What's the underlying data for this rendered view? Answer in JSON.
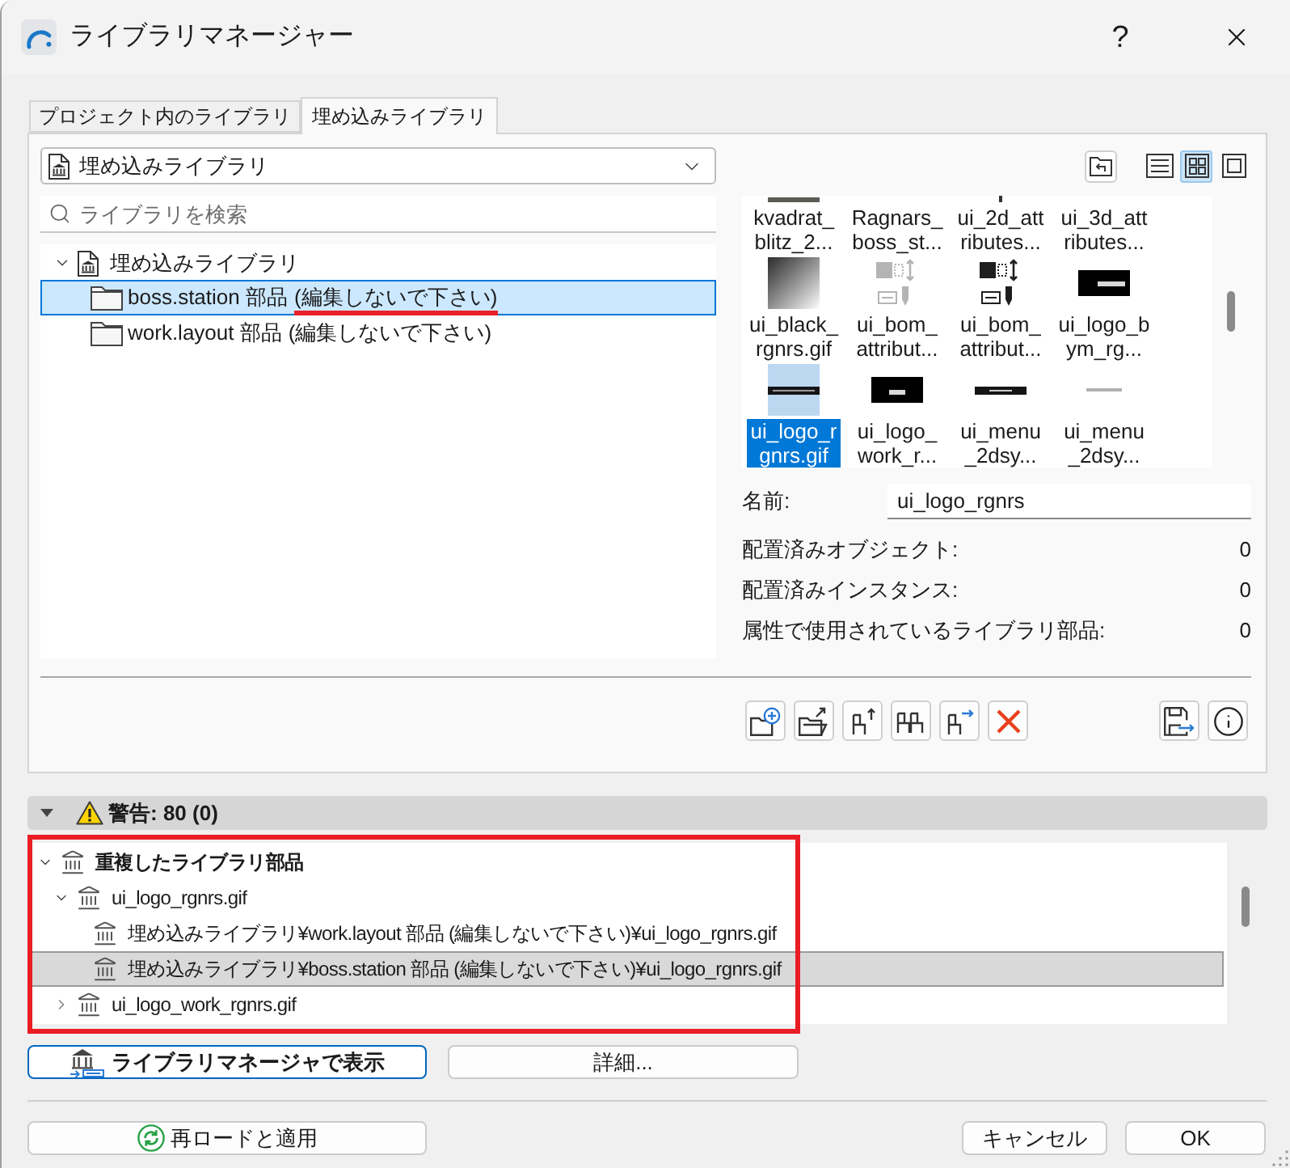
{
  "window": {
    "title": "ライブラリマネージャー",
    "help": "?"
  },
  "tabs": [
    {
      "label": "プロジェクト内のライブラリ",
      "selected": false
    },
    {
      "label": "埋め込みライブラリ",
      "selected": true
    }
  ],
  "library_select": {
    "value": "埋め込みライブラリ"
  },
  "search": {
    "placeholder": "ライブラリを検索"
  },
  "library_tree": [
    {
      "label": "埋め込みライブラリ",
      "expanded": true,
      "selected": false,
      "children": [
        {
          "name": "boss.station 部品",
          "note": "(編集しないで下さい)",
          "selected": true,
          "underlined": true
        },
        {
          "name": "work.layout 部品",
          "note": "(編集しないで下さい)",
          "selected": false,
          "underlined": false
        }
      ]
    }
  ],
  "view_modes": [
    {
      "kind": "list",
      "selected": false
    },
    {
      "kind": "grid",
      "selected": true
    },
    {
      "kind": "preview",
      "selected": false
    }
  ],
  "thumbnails": [
    {
      "lines": [
        "kvadrat_",
        "blitz_2..."
      ],
      "kind": "cut-bar",
      "selected": false
    },
    {
      "lines": [
        "Ragnars_",
        "boss_st..."
      ],
      "kind": "blank",
      "selected": false
    },
    {
      "lines": [
        "ui_2d_att",
        "ributes..."
      ],
      "kind": "cut-mark",
      "selected": false
    },
    {
      "lines": [
        "ui_3d_att",
        "ributes..."
      ],
      "kind": "blank",
      "selected": false
    },
    {
      "lines": [
        "ui_black_",
        "rgnrs.gif"
      ],
      "kind": "gradient",
      "selected": false
    },
    {
      "lines": [
        "ui_bom_",
        "attribut..."
      ],
      "kind": "symbol-faded",
      "selected": false
    },
    {
      "lines": [
        "ui_bom_",
        "attribut..."
      ],
      "kind": "symbol",
      "selected": false
    },
    {
      "lines": [
        "ui_logo_b",
        "ym_rg..."
      ],
      "kind": "banner",
      "selected": false
    },
    {
      "lines": [
        "ui_logo_r",
        "gnrs.gif"
      ],
      "kind": "strip",
      "selected": true
    },
    {
      "lines": [
        "ui_logo_",
        "work_r..."
      ],
      "kind": "block",
      "selected": false
    },
    {
      "lines": [
        "ui_menu",
        "_2dsy..."
      ],
      "kind": "bar",
      "selected": false
    },
    {
      "lines": [
        "ui_menu",
        "_2dsy..."
      ],
      "kind": "tiny",
      "selected": false
    }
  ],
  "properties": {
    "name_label": "名前:",
    "name_value": "ui_logo_rgnrs",
    "rows": [
      {
        "label": "配置済みオブジェクト:",
        "value": "0"
      },
      {
        "label": "配置済みインスタンス:",
        "value": "0"
      },
      {
        "label": "属性で使用されているライブラリ部品:",
        "value": "0"
      }
    ]
  },
  "warnings": {
    "title": "警告: 80 (0)",
    "expanded": true,
    "framed": true,
    "tree": [
      {
        "label": "重複したライブラリ部品",
        "expanded": true,
        "selected": false,
        "children": [
          {
            "label": "ui_logo_rgnrs.gif",
            "expanded": true,
            "selected": false,
            "children": [
              {
                "label": "埋め込みライブラリ¥work.layout 部品 (編集しないで下さい)¥ui_logo_rgnrs.gif",
                "selected": false
              },
              {
                "label": "埋め込みライブラリ¥boss.station 部品 (編集しないで下さい)¥ui_logo_rgnrs.gif",
                "selected": true
              }
            ]
          },
          {
            "label": "ui_logo_work_rgnrs.gif",
            "expanded": false,
            "selected": false
          }
        ]
      }
    ]
  },
  "actions": [
    {
      "label": "ライブラリマネージャで表示",
      "kind": "primary"
    },
    {
      "label": "詳細...",
      "kind": "plain"
    }
  ],
  "footer": {
    "reload": "再ロードと適用",
    "cancel": "キャンセル",
    "ok": "OK"
  }
}
